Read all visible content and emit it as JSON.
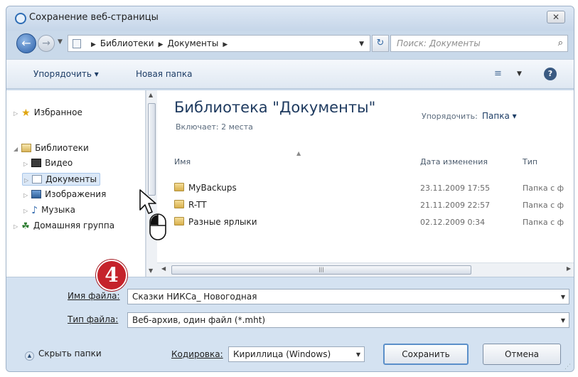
{
  "window": {
    "title": "Сохранение веб-страницы",
    "close_label": "✕"
  },
  "navigation": {
    "breadcrumb": [
      "Библиотеки",
      "Документы"
    ],
    "search_placeholder": "Поиск: Документы"
  },
  "toolbar": {
    "organize_label": "Упорядочить ▾",
    "new_folder_label": "Новая папка",
    "help_label": "?"
  },
  "sidebar": {
    "items": [
      {
        "label": "Избранное",
        "icon": "star-icon"
      },
      {
        "label": "Библиотеки",
        "icon": "library-icon"
      },
      {
        "label": "Видео",
        "icon": "video-icon"
      },
      {
        "label": "Документы",
        "icon": "document-icon",
        "selected": true
      },
      {
        "label": "Изображения",
        "icon": "image-icon"
      },
      {
        "label": "Музыка",
        "icon": "music-icon"
      },
      {
        "label": "Домашняя группа",
        "icon": "homegroup-icon"
      }
    ]
  },
  "library": {
    "title": "Библиотека \"Документы\"",
    "subtitle": "Включает: 2 места",
    "arrange_label": "Упорядочить:",
    "arrange_value": "Папка ▾"
  },
  "file_list": {
    "columns": [
      "Имя",
      "Дата изменения",
      "Тип"
    ],
    "rows": [
      {
        "name": "MyBackups",
        "date": "23.11.2009 17:55",
        "type": "Папка с ф"
      },
      {
        "name": "R-TT",
        "date": "21.11.2009 22:57",
        "type": "Папка с ф"
      },
      {
        "name": "Разные ярлыки",
        "date": "02.12.2009 0:34",
        "type": "Папка с ф"
      }
    ]
  },
  "form": {
    "filename_label": "Имя файла:",
    "filename_value": "Сказки НИКСа_ Новогодная",
    "filetype_label": "Тип файла:",
    "filetype_value": "Веб-архив, один файл (*.mht)",
    "encoding_label": "Кодировка:",
    "encoding_value": "Кириллица (Windows)",
    "hide_folders_label": "Скрыть папки",
    "save_label": "Сохранить",
    "cancel_label": "Отмена"
  },
  "annotation": {
    "step_number": "4"
  }
}
